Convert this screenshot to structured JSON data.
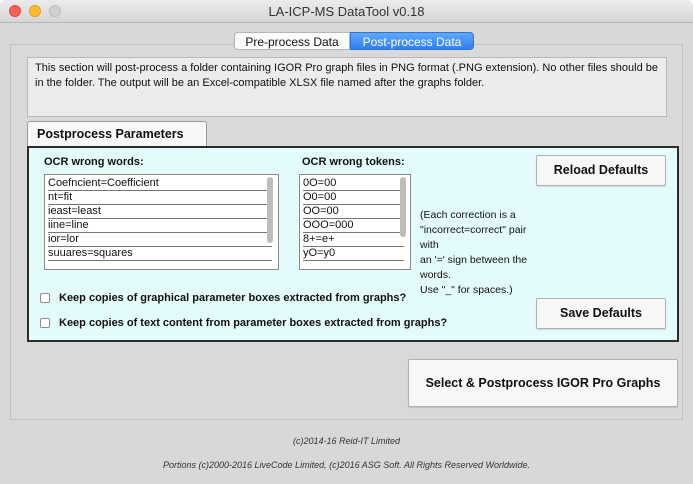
{
  "window": {
    "title": "LA-ICP-MS DataTool v0.18"
  },
  "tabs": [
    {
      "label": "Pre-process Data",
      "selected": false
    },
    {
      "label": "Post-process Data",
      "selected": true
    }
  ],
  "info": {
    "text": "This section will post-process a folder containing IGOR Pro graph files in PNG format (.PNG extension).  No other files should be in the folder. The output will be an Excel-compatible XLSX file named after the graphs folder."
  },
  "params": {
    "tab_label": "Postprocess Parameters",
    "ocr_words_label": "OCR wrong words:",
    "ocr_words": [
      "Coefncient=Coefficient",
      "nt=fit",
      "ieast=least",
      "iine=line",
      "ior=lor",
      "suuares=squares"
    ],
    "ocr_tokens_label": "OCR wrong tokens:",
    "ocr_tokens": [
      "0O=00",
      "O0=00",
      "OO=00",
      "OOO=000",
      "8+=e+",
      "yO=y0"
    ],
    "reload_label": "Reload Defaults",
    "save_label": "Save Defaults",
    "note_lines": [
      "(Each correction is a",
      "\"incorrect=correct\" pair with",
      "an '=' sign between the words.",
      "Use \"_\" for spaces.)"
    ],
    "keep_boxes_label": "Keep copies of graphical parameter boxes extracted from graphs?",
    "keep_text_label": "Keep copies of text content from parameter boxes extracted from graphs?"
  },
  "action": {
    "label": "Select & Postprocess IGOR Pro Graphs"
  },
  "footer": {
    "line1": "(c)2014-16 Reid-IT Limited",
    "line2": "Portions (c)2000-2016 LiveCode Limited, (c)2016 ASG Soft. All Rights Reserved Worldwide."
  }
}
